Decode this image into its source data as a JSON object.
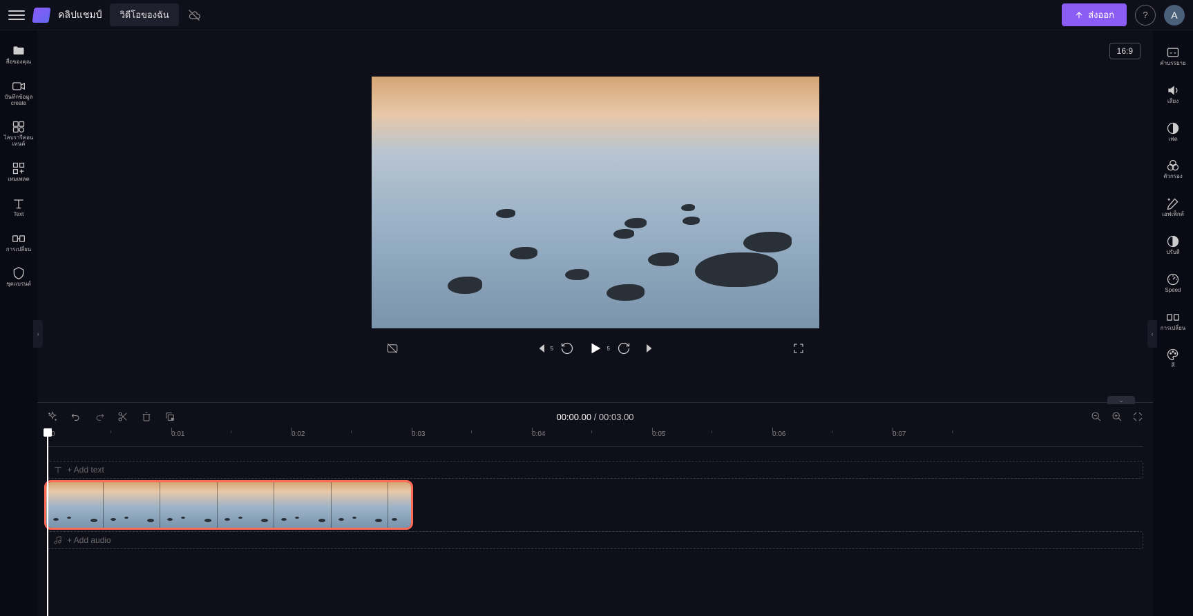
{
  "header": {
    "project_name": "คลิปแชมป์",
    "tab_my_videos": "วิดีโอของฉัน",
    "export_label": "ส่งออก",
    "avatar_initial": "A",
    "aspect_ratio": "16:9"
  },
  "left_sidebar": {
    "items": [
      {
        "label": "สื่อของคุณ"
      },
      {
        "label": "บันทึกข้อมูล\ncreate"
      },
      {
        "label": "ไลบรารีคอนเทนต์"
      },
      {
        "label": "เทมเพลต"
      },
      {
        "label": "Text"
      },
      {
        "label": "การเปลี่ยน"
      },
      {
        "label": "ชุดแบรนด์"
      }
    ]
  },
  "right_sidebar": {
    "items": [
      {
        "label": "คำบรรยาย"
      },
      {
        "label": "เสียง"
      },
      {
        "label": "เฟด"
      },
      {
        "label": "ตัวกรอง"
      },
      {
        "label": "เอฟเฟ็กต์"
      },
      {
        "label": "ปรับสี"
      },
      {
        "label": "Speed"
      },
      {
        "label": "การเปลี่ยน"
      },
      {
        "label": "สี"
      }
    ]
  },
  "timeline": {
    "current_time": "00:00.00",
    "total_time": "00:03.00",
    "add_text_label": "+ Add text",
    "add_audio_label": "+ Add audio",
    "ruler_ticks": [
      "0",
      "0:01",
      "0:02",
      "0:03",
      "0:04",
      "0:05",
      "0:06",
      "0:07"
    ]
  },
  "colors": {
    "accent": "#8b5cf6",
    "highlight": "#ff6b57"
  }
}
